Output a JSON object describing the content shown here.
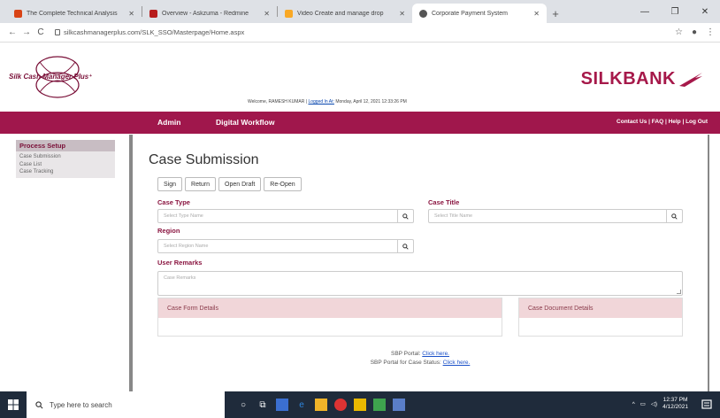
{
  "browser": {
    "tabs": [
      {
        "label": "The Complete Technical Analysis",
        "favicon_color": "#d84315",
        "active": false
      },
      {
        "label": "Overview - Askzuma - Redmine",
        "favicon_color": "#b71c1c",
        "active": false
      },
      {
        "label": "Video Create and manage drop",
        "favicon_color": "#f9a825",
        "active": false
      },
      {
        "label": "Corporate Payment System",
        "favicon_color": "#555555",
        "active": true
      }
    ],
    "url": "silkcashmanagerplus.com/SLK_SSO/Masterpage/Home.aspx"
  },
  "header": {
    "logo_text": "Silk Cash Manager Plus⁺",
    "brand": "SILKBANK",
    "welcome_prefix": "Welcome, RAMESH KUMAR |",
    "logged_label": "Logged In At:",
    "logged_time": "Monday, April 12, 2021 12:33:26 PM"
  },
  "nav": {
    "items": [
      "Admin",
      "Digital Workflow"
    ],
    "right": "Contact Us | FAQ | Help | Log Out"
  },
  "sidebar": {
    "heading": "Process Setup",
    "items": [
      "Case Submission",
      "Case List",
      "Case Tracking"
    ]
  },
  "main": {
    "title": "Case Submission",
    "buttons": [
      "Sign",
      "Return",
      "Open Draft",
      "Re-Open"
    ],
    "case_type_label": "Case Type",
    "case_type_placeholder": "Select Type Name",
    "case_title_label": "Case Title",
    "case_title_placeholder": "Select Title Name",
    "region_label": "Region",
    "region_placeholder": "Select Region Name",
    "remarks_label": "User Remarks",
    "remarks_placeholder": "Case Remarks",
    "form_details": "Case Form Details",
    "document_details": "Case Document Details",
    "sbp_prefix": "SBP Portal:",
    "sbp_link": "Click here.",
    "sbp_status_prefix": "SBP Portal for Case Status:",
    "sbp_status_link": "Click here."
  },
  "taskbar": {
    "search_placeholder": "Type here to search",
    "time": "12:37 PM",
    "date": "4/12/2021"
  },
  "colors": {
    "brand": "#a0174c",
    "label": "#8a1540",
    "panel_header": "#f1d6d9"
  }
}
